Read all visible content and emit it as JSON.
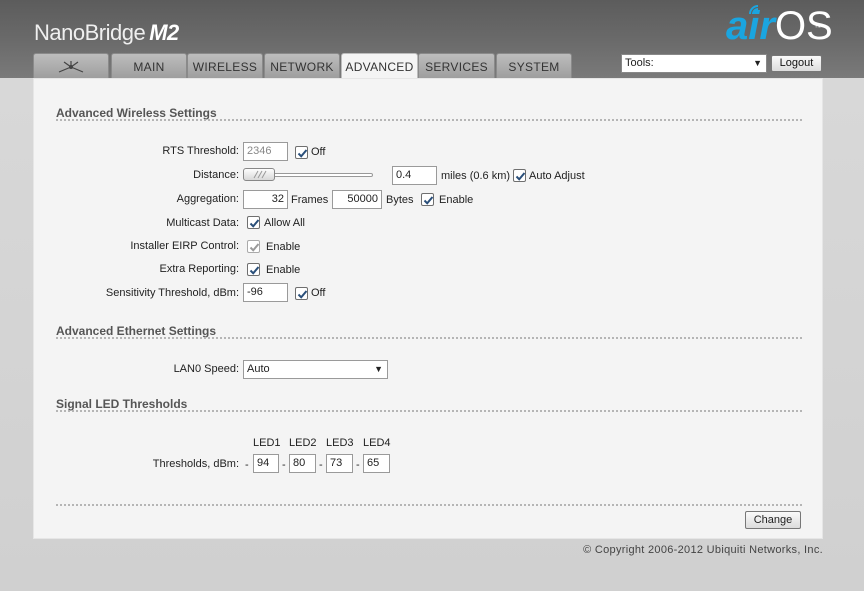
{
  "header": {
    "product_name": "NanoBridge",
    "product_model": "M2",
    "logo_air": "air",
    "logo_os": "OS",
    "logo_tm": "™"
  },
  "tabs": [
    {
      "label": "",
      "icon": "ubiquiti-logo-icon",
      "active": false
    },
    {
      "label": "MAIN",
      "active": false
    },
    {
      "label": "WIRELESS",
      "active": false
    },
    {
      "label": "NETWORK",
      "active": false
    },
    {
      "label": "ADVANCED",
      "active": true
    },
    {
      "label": "SERVICES",
      "active": false
    },
    {
      "label": "SYSTEM",
      "active": false
    }
  ],
  "toolbar": {
    "tools_value": "Tools:",
    "logout_label": "Logout"
  },
  "wireless": {
    "title": "Advanced Wireless Settings",
    "rts_label": "RTS Threshold:",
    "rts_value": "2346",
    "rts_off_label": "Off",
    "distance_label": "Distance:",
    "distance_value": "0.4",
    "distance_units": "miles (0.6 km)",
    "auto_adjust_label": "Auto Adjust",
    "aggregation_label": "Aggregation:",
    "aggregation_frames_value": "32",
    "frames_label": "Frames",
    "aggregation_bytes_value": "50000",
    "bytes_label": "Bytes",
    "aggregation_enable_label": "Enable",
    "multicast_label": "Multicast Data:",
    "multicast_allow_label": "Allow All",
    "eirp_label": "Installer EIRP Control:",
    "eirp_enable_label": "Enable",
    "extra_label": "Extra Reporting:",
    "extra_enable_label": "Enable",
    "sensitivity_label": "Sensitivity Threshold, dBm:",
    "sensitivity_value": "-96",
    "sensitivity_off_label": "Off"
  },
  "ethernet": {
    "title": "Advanced Ethernet Settings",
    "lan0_label": "LAN0 Speed:",
    "lan0_value": "Auto"
  },
  "led": {
    "title": "Signal LED Thresholds",
    "thresholds_label": "Thresholds, dBm:",
    "headers": [
      "LED1",
      "LED2",
      "LED3",
      "LED4"
    ],
    "values": [
      "94",
      "80",
      "73",
      "65"
    ],
    "dash": "-"
  },
  "footer": {
    "change_label": "Change",
    "copyright": "© Copyright 2006-2012 Ubiquiti Networks, Inc."
  }
}
